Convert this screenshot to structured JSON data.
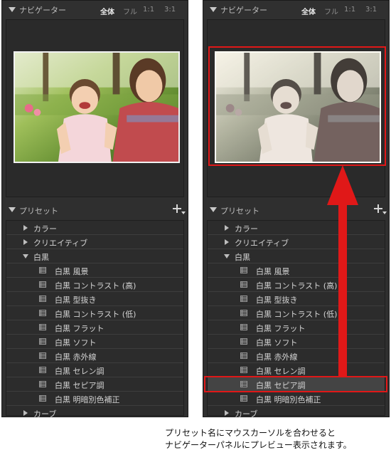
{
  "navigator": {
    "title": "ナビゲーター",
    "zoom_options": [
      "全体",
      "フル",
      "1:1",
      "3:1"
    ],
    "active_zoom": "全体"
  },
  "presets": {
    "title": "プリセット",
    "items": [
      {
        "type": "folder",
        "label": "カラー",
        "expanded": false
      },
      {
        "type": "folder",
        "label": "クリエイティブ",
        "expanded": false
      },
      {
        "type": "folder",
        "label": "白黒",
        "expanded": true
      },
      {
        "type": "preset",
        "label": "白黒 風景"
      },
      {
        "type": "preset",
        "label": "白黒 コントラスト (高)"
      },
      {
        "type": "preset",
        "label": "白黒 型抜き"
      },
      {
        "type": "preset",
        "label": "白黒 コントラスト (低)"
      },
      {
        "type": "preset",
        "label": "白黒 フラット"
      },
      {
        "type": "preset",
        "label": "白黒 ソフト"
      },
      {
        "type": "preset",
        "label": "白黒 赤外線"
      },
      {
        "type": "preset",
        "label": "白黒 セレン調"
      },
      {
        "type": "preset",
        "label": "白黒 セピア調"
      },
      {
        "type": "preset",
        "label": "白黒 明暗別色補正"
      },
      {
        "type": "folder",
        "label": "カーブ",
        "expanded": false
      }
    ],
    "hovered_item": "白黒 セピア調"
  },
  "caption": {
    "line1": "プリセット名にマウスカーソルを合わせると",
    "line2": "ナビゲーターパネルにプレビュー表示されます。"
  },
  "colors": {
    "panel_bg": "#2f2f2f",
    "highlight_red": "#e01818",
    "hover_row": "#444444"
  }
}
